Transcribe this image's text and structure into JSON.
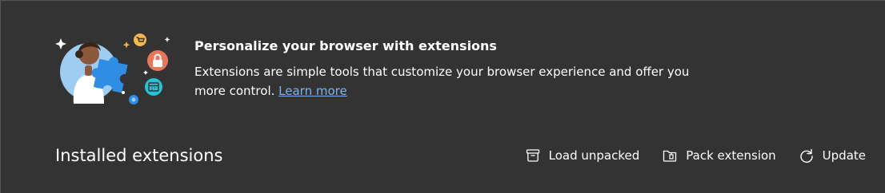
{
  "promo": {
    "title": "Personalize your browser with extensions",
    "description": "Extensions are simple tools that customize your browser experience and offer you more control.",
    "learn_more": "Learn more"
  },
  "installed": {
    "title": "Installed extensions",
    "actions": {
      "load_unpacked": "Load unpacked",
      "pack_extension": "Pack extension",
      "update": "Update"
    }
  },
  "colors": {
    "background": "#333333",
    "link": "#7ab4f0",
    "puzzle": "#2f8de4",
    "lock_badge": "#e8775a",
    "cart_badge": "#f2b84b",
    "calendar_badge": "#27c4d6"
  },
  "icons": [
    "extensions-illustration",
    "load-unpacked-icon",
    "pack-extension-icon",
    "update-icon"
  ]
}
